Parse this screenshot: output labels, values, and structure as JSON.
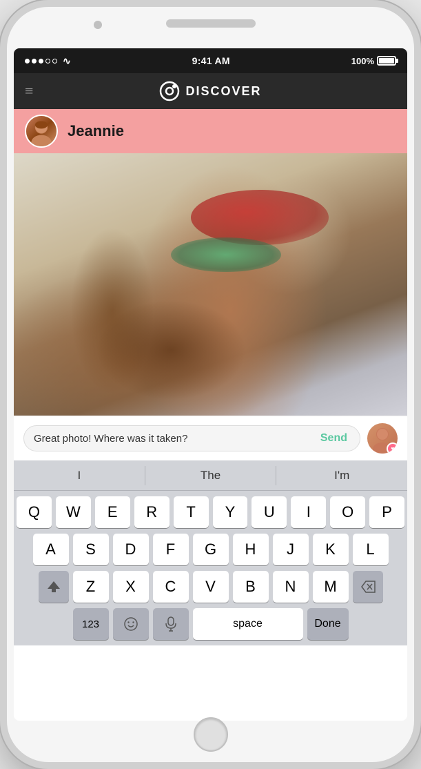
{
  "statusBar": {
    "time": "9:41 AM",
    "battery": "100%"
  },
  "navBar": {
    "title": "DISCOVER",
    "logoAlt": "discover-logo"
  },
  "profile": {
    "name": "Jeannie",
    "avatarAlt": "jeannie-avatar"
  },
  "messageInput": {
    "text": "Great photo! Where was it taken?",
    "sendLabel": "Send"
  },
  "autocomplete": {
    "items": [
      "I",
      "The",
      "I'm"
    ]
  },
  "keyboard": {
    "rows": [
      [
        "Q",
        "W",
        "E",
        "R",
        "T",
        "Y",
        "U",
        "I",
        "O",
        "P"
      ],
      [
        "A",
        "S",
        "D",
        "F",
        "G",
        "H",
        "J",
        "K",
        "L"
      ],
      [
        "Z",
        "X",
        "C",
        "V",
        "B",
        "N",
        "M"
      ]
    ],
    "bottomRow": {
      "numbers": "123",
      "emoji": "😊",
      "mic": "🎤",
      "space": "space",
      "done": "Done"
    }
  },
  "heartIcon": "♥"
}
